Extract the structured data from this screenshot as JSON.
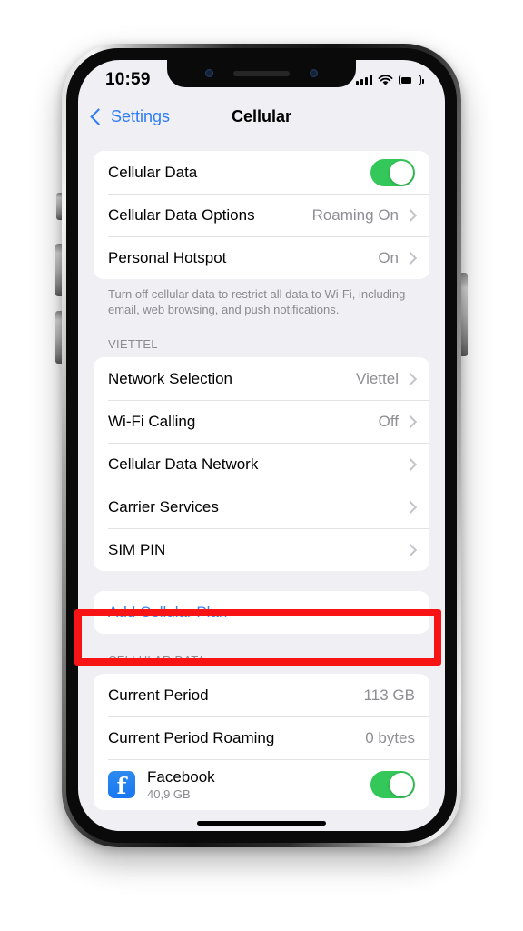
{
  "status_bar": {
    "time": "10:59",
    "signal_icon": "cellular-signal-icon",
    "wifi_icon": "wifi-icon",
    "battery_icon": "battery-icon"
  },
  "nav": {
    "back_label": "Settings",
    "title": "Cellular",
    "back_icon": "chevron-left-icon"
  },
  "groups": {
    "data_group": [
      {
        "label": "Cellular Data",
        "value": "",
        "control": "toggle",
        "toggle_on": true
      },
      {
        "label": "Cellular Data Options",
        "value": "Roaming On",
        "control": "chevron"
      },
      {
        "label": "Personal Hotspot",
        "value": "On",
        "control": "chevron"
      }
    ],
    "data_footnote": "Turn off cellular data to restrict all data to Wi-Fi, including email, web browsing, and push notifications.",
    "carrier_header": "VIETTEL",
    "carrier_group": [
      {
        "label": "Network Selection",
        "value": "Viettel",
        "control": "chevron"
      },
      {
        "label": "Wi-Fi Calling",
        "value": "Off",
        "control": "chevron"
      },
      {
        "label": "Cellular Data Network",
        "value": "",
        "control": "chevron"
      },
      {
        "label": "Carrier Services",
        "value": "",
        "control": "chevron"
      },
      {
        "label": "SIM PIN",
        "value": "",
        "control": "chevron"
      }
    ],
    "add_plan_label": "Add Cellular Plan",
    "usage_header": "CELLULAR DATA",
    "usage_group": [
      {
        "label": "Current Period",
        "value": "113 GB"
      },
      {
        "label": "Current Period Roaming",
        "value": "0 bytes"
      }
    ],
    "app_row": {
      "name": "Facebook",
      "usage": "40,9 GB",
      "icon": "facebook-icon",
      "glyph": "f",
      "toggle_on": true
    }
  },
  "annotation": {
    "name": "red-highlight-box",
    "color": "#f81414",
    "targets": "Add Cellular Plan"
  },
  "colors": {
    "toggle_green": "#34c759",
    "link_blue": "#3a85f0",
    "nav_blue": "#2f7cf6",
    "screen_background": "#efeff4",
    "row_background": "#ffffff",
    "secondary_text": "#8e8e93"
  }
}
